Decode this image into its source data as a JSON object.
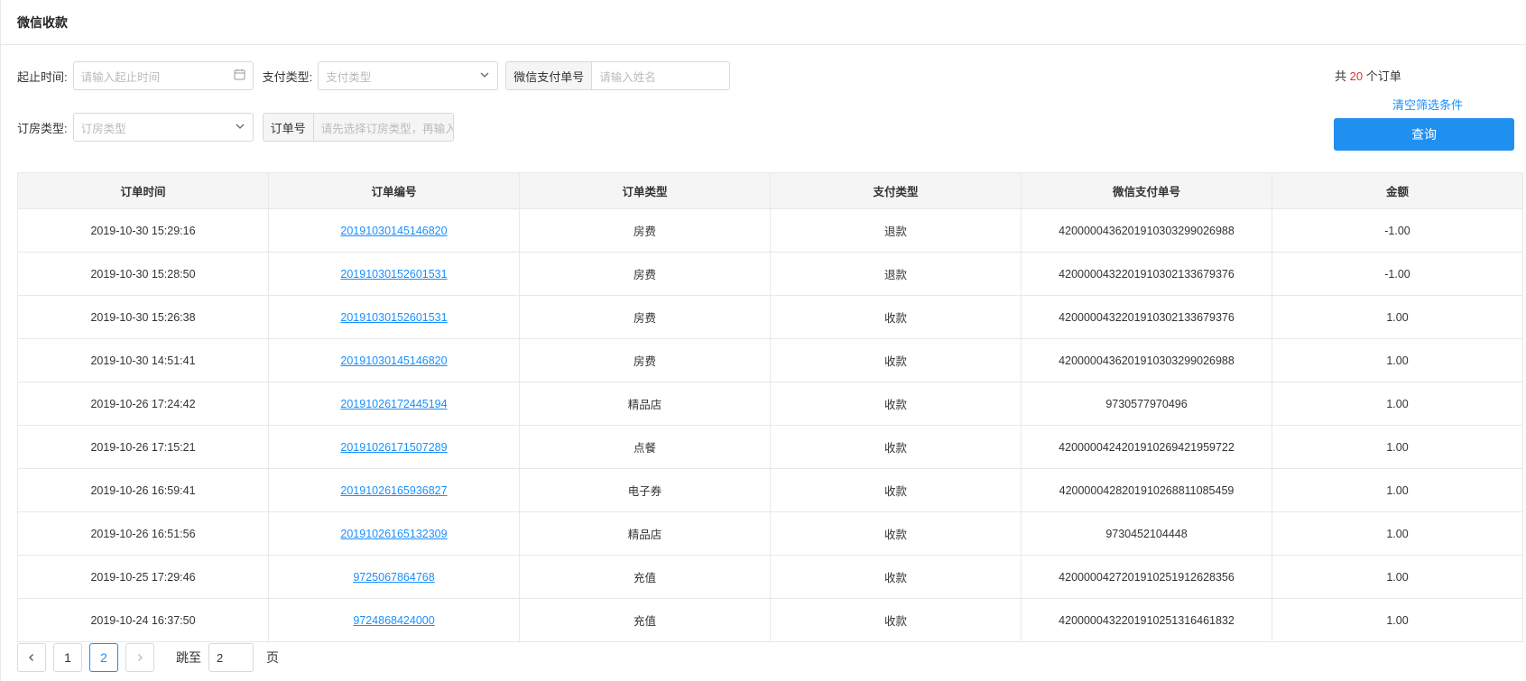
{
  "title": "微信收款",
  "filters": {
    "time_label": "起止时间:",
    "time_placeholder": "请输入起止时间",
    "pay_type_label": "支付类型:",
    "pay_type_placeholder": "支付类型",
    "wx_no_addon": "微信支付单号",
    "wx_no_placeholder": "请输入姓名",
    "room_type_label": "订房类型:",
    "room_type_placeholder": "订房类型",
    "order_no_addon": "订单号",
    "order_no_placeholder": "请先选择订房类型，再输入"
  },
  "summary": {
    "prefix": "共 ",
    "count": "20",
    "suffix": " 个订单"
  },
  "clear_label": "清空筛选条件",
  "query_label": "查询",
  "table": {
    "headers": [
      "订单时间",
      "订单编号",
      "订单类型",
      "支付类型",
      "微信支付单号",
      "金额"
    ],
    "rows": [
      [
        "2019-10-30 15:29:16",
        "20191030145146820",
        "房费",
        "退款",
        "4200000436201910303299026988",
        "-1.00"
      ],
      [
        "2019-10-30 15:28:50",
        "20191030152601531",
        "房费",
        "退款",
        "4200000432201910302133679376",
        "-1.00"
      ],
      [
        "2019-10-30 15:26:38",
        "20191030152601531",
        "房费",
        "收款",
        "4200000432201910302133679376",
        "1.00"
      ],
      [
        "2019-10-30 14:51:41",
        "20191030145146820",
        "房费",
        "收款",
        "4200000436201910303299026988",
        "1.00"
      ],
      [
        "2019-10-26 17:24:42",
        "20191026172445194",
        "精品店",
        "收款",
        "9730577970496",
        "1.00"
      ],
      [
        "2019-10-26 17:15:21",
        "20191026171507289",
        "点餐",
        "收款",
        "4200000424201910269421959722",
        "1.00"
      ],
      [
        "2019-10-26 16:59:41",
        "20191026165936827",
        "电子券",
        "收款",
        "4200000428201910268811085459",
        "1.00"
      ],
      [
        "2019-10-26 16:51:56",
        "20191026165132309",
        "精品店",
        "收款",
        "9730452104448",
        "1.00"
      ],
      [
        "2019-10-25 17:29:46",
        "9725067864768",
        "充值",
        "收款",
        "4200000427201910251912628356",
        "1.00"
      ],
      [
        "2019-10-24 16:37:50",
        "9724868424000",
        "充值",
        "收款",
        "4200000432201910251316461832",
        "1.00"
      ]
    ]
  },
  "pagination": {
    "prev_icon": "chevron-left-icon",
    "next_icon": "chevron-right-icon",
    "pages": [
      "1",
      "2"
    ],
    "current": "2",
    "jump_label": "跳至",
    "jump_value": "2",
    "page_label": "页"
  },
  "colors": {
    "accent": "#1f8ff0",
    "count": "#e5322d",
    "link": "#1890ff"
  }
}
